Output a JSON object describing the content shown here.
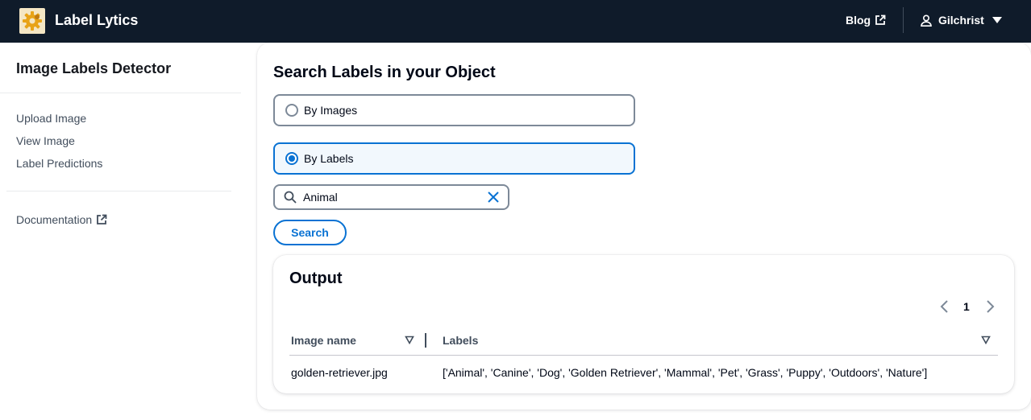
{
  "header": {
    "app_title": "Label Lytics",
    "blog_label": "Blog",
    "user_name": "Gilchrist"
  },
  "sidebar": {
    "title": "Image Labels Detector",
    "items": [
      {
        "label": "Upload Image"
      },
      {
        "label": "View Image"
      },
      {
        "label": "Label Predictions"
      }
    ],
    "documentation_label": "Documentation"
  },
  "main": {
    "title": "Search Labels in your Object",
    "options": [
      {
        "label": "By Images",
        "selected": false
      },
      {
        "label": "By Labels",
        "selected": true
      }
    ],
    "search": {
      "value": "Animal"
    },
    "search_button_label": "Search"
  },
  "output": {
    "title": "Output",
    "current_page": "1",
    "columns": [
      "Image name",
      "Labels"
    ],
    "rows": [
      {
        "image_name": "golden-retriever.jpg",
        "labels": "['Animal', 'Canine', 'Dog', 'Golden Retriever', 'Mammal', 'Pet', 'Grass', 'Puppy', 'Outdoors', 'Nature']"
      }
    ]
  },
  "colors": {
    "header_bg": "#0f1b2a",
    "accent": "#0972d3",
    "border": "#7d8998"
  },
  "icons": [
    "gear-logo-icon",
    "external-link-icon",
    "user-icon",
    "caret-down-icon",
    "search-icon",
    "clear-icon",
    "chevron-left-icon",
    "chevron-right-icon",
    "sort-icon"
  ]
}
